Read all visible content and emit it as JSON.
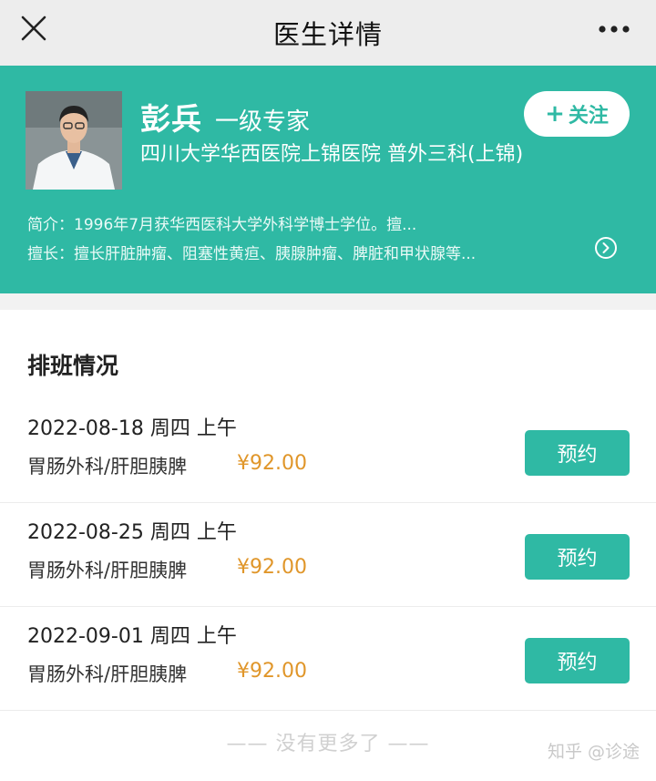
{
  "header": {
    "title": "医生详情"
  },
  "doctor": {
    "name": "彭兵",
    "title": "一级专家",
    "hospital": "四川大学华西医院上锦医院 普外三科(上锦)",
    "follow_label": "关注",
    "intro": "简介：1996年7月获华西医科大学外科学博士学位。擅...",
    "expertise": "擅长：擅长肝脏肿瘤、阻塞性黄疸、胰腺肿瘤、脾脏和甲状腺等..."
  },
  "schedule": {
    "title": "排班情况",
    "rows": [
      {
        "date": "2022-08-18 周四 上午",
        "dept": "胃肠外科/肝胆胰脾",
        "price": "¥92.00",
        "button": "预约"
      },
      {
        "date": "2022-08-25 周四 上午",
        "dept": "胃肠外科/肝胆胰脾",
        "price": "¥92.00",
        "button": "预约"
      },
      {
        "date": "2022-09-01 周四 上午",
        "dept": "胃肠外科/肝胆胰脾",
        "price": "¥92.00",
        "button": "预约"
      }
    ],
    "no_more": "—— 没有更多了 ——"
  },
  "watermark": "知乎 @诊途",
  "icons": {
    "close": "close-icon",
    "more": "more-dots-icon",
    "plus": "plus-icon",
    "chevron": "chevron-right-circle-icon",
    "avatar": "doctor-photo"
  },
  "colors": {
    "accent": "#2fb9a4",
    "price": "#e0962a",
    "topbar": "#ededed"
  }
}
